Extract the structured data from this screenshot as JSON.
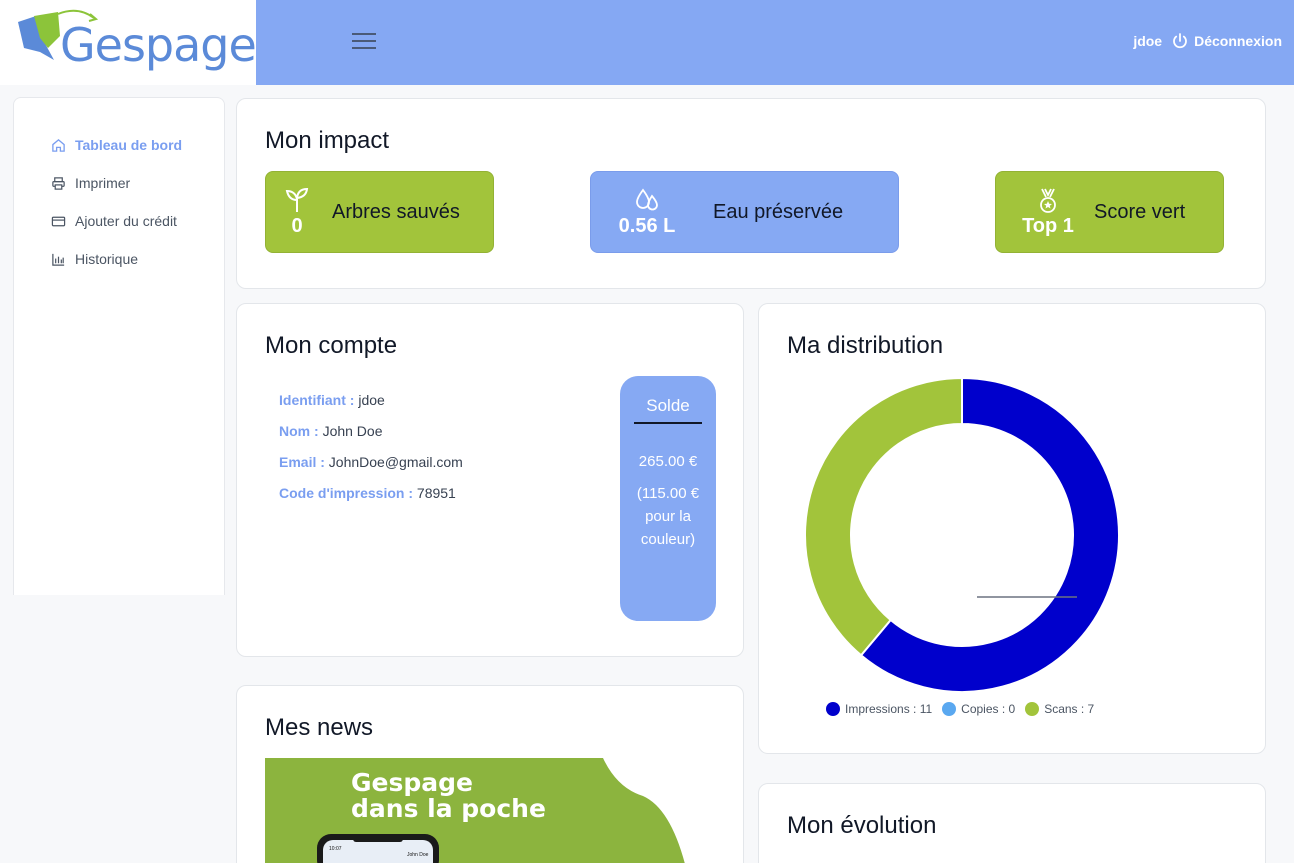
{
  "brand": {
    "name": "Gespage",
    "logo_color": "#5b8ad8",
    "topbar_color": "#85a8f3"
  },
  "header": {
    "menu_icon": "hamburger-icon",
    "username": "jdoe",
    "logout_label": "Déconnexion",
    "logout_icon": "power-icon"
  },
  "sidebar": {
    "items": [
      {
        "label": "Tableau de bord",
        "icon": "home-icon",
        "active": true
      },
      {
        "label": "Imprimer",
        "icon": "printer-icon",
        "active": false
      },
      {
        "label": "Ajouter du crédit",
        "icon": "credit-card-icon",
        "active": false
      },
      {
        "label": "Historique",
        "icon": "bar-chart-icon",
        "active": false
      }
    ]
  },
  "impact": {
    "title": "Mon impact",
    "boxes": [
      {
        "value": "0",
        "label": "Arbres sauvés",
        "icon": "sprout-icon",
        "color": "#a2c43b"
      },
      {
        "value": "0.56 L",
        "label": "Eau préservée",
        "icon": "water-drops-icon",
        "color": "#86a9f3"
      },
      {
        "value": "Top 1",
        "label": "Score vert",
        "icon": "medal-icon",
        "color": "#a2c43b"
      }
    ]
  },
  "account": {
    "title": "Mon compte",
    "fields": [
      {
        "key": "Identifiant :",
        "value": "jdoe"
      },
      {
        "key": "Nom :",
        "value": "John Doe"
      },
      {
        "key": "Email :",
        "value": "JohnDoe@gmail.com"
      },
      {
        "key": "Code d'impression :",
        "value": "78951"
      }
    ],
    "balance": {
      "title": "Solde",
      "amount": "265.00 €",
      "color_amount": "(115.00 € pour la couleur)"
    }
  },
  "distribution": {
    "title": "Ma distribution",
    "chart_data": {
      "type": "pie",
      "series": [
        {
          "name": "Impressions",
          "value": 11,
          "color": "#0000cc"
        },
        {
          "name": "Copies",
          "value": 0,
          "color": "#5aa8f0"
        },
        {
          "name": "Scans",
          "value": 7,
          "color": "#a2c43b"
        }
      ],
      "legend_labels": [
        "Impressions : 11",
        "Copies : 0",
        "Scans : 7"
      ],
      "legend": "bottom"
    }
  },
  "news": {
    "title": "Mes news",
    "banner_text_1": "Gespage",
    "banner_text_2": "dans la poche"
  },
  "evolution": {
    "title": "Mon évolution"
  }
}
